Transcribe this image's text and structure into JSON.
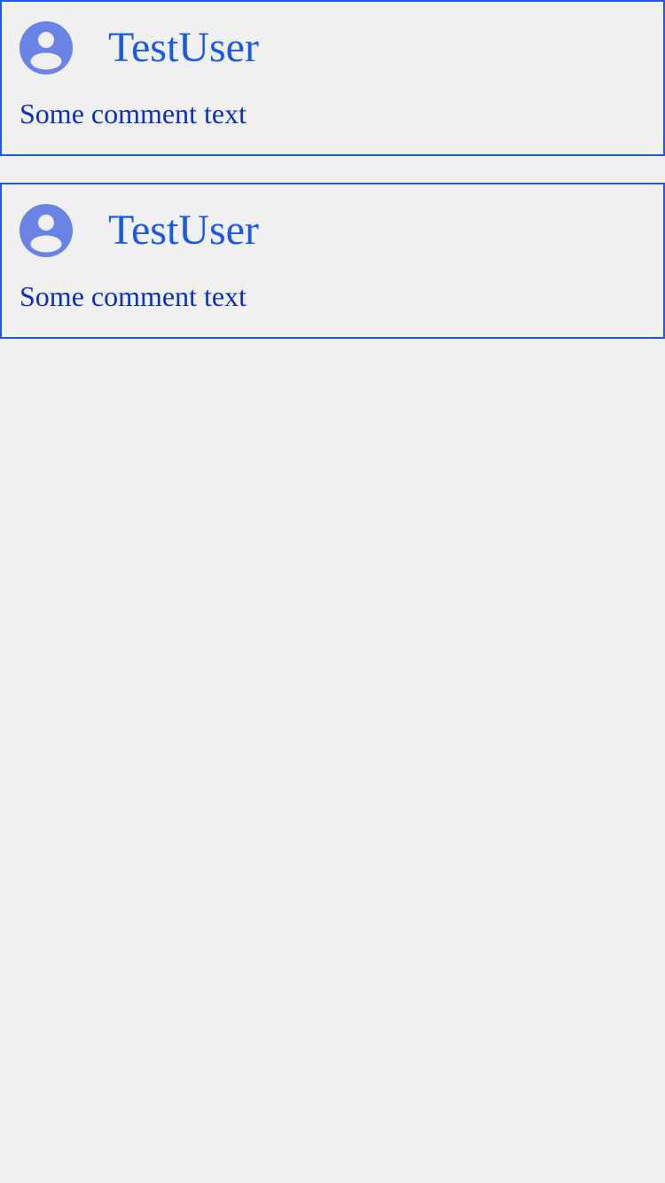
{
  "colors": {
    "background": "#f0f0f0",
    "card_border": "#1a5ae8",
    "username": "#1a5ae8",
    "comment_text": "#0b2fc0",
    "avatar": "#6a84e6"
  },
  "comments": [
    {
      "avatar_icon": "account-circle-icon",
      "username": "TestUser",
      "text": "Some comment text"
    },
    {
      "avatar_icon": "account-circle-icon",
      "username": "TestUser",
      "text": "Some comment text"
    }
  ]
}
